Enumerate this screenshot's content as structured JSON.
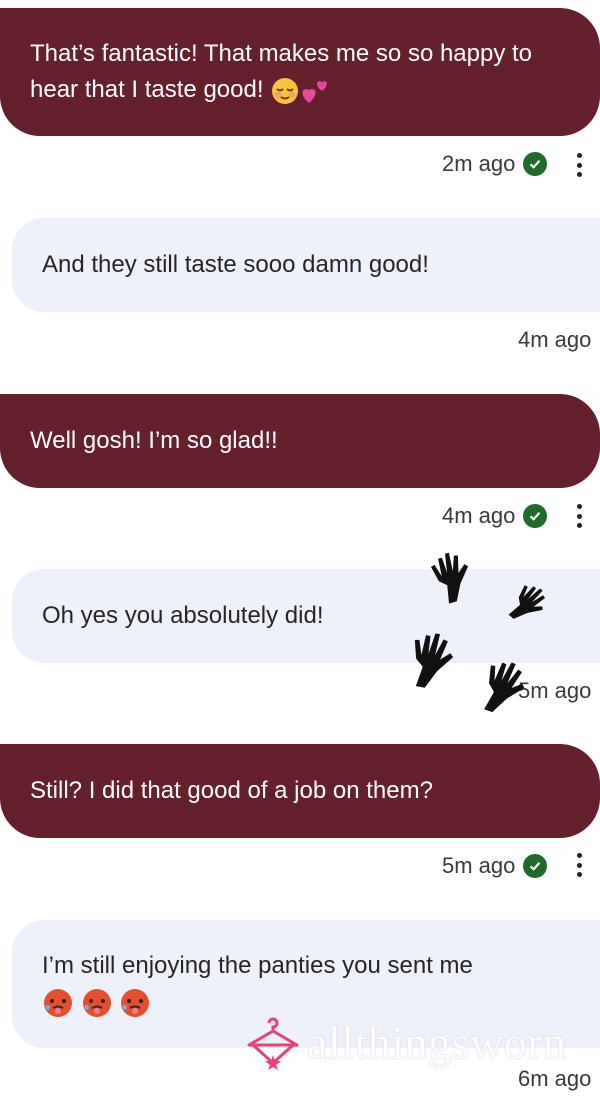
{
  "messages": [
    {
      "role": "sent",
      "text": "That’s fantastic! That makes me so so happy to hear that I taste good!",
      "emoji": [
        "relieved-face",
        "two-hearts"
      ],
      "time": "2m ago"
    },
    {
      "role": "received",
      "text": "And they still taste sooo damn good!",
      "time": "4m ago"
    },
    {
      "role": "sent",
      "text": "Well gosh! I’m so glad!!",
      "time": "4m ago"
    },
    {
      "role": "received",
      "text": "Oh yes you absolutely did!",
      "time": "5m ago"
    },
    {
      "role": "sent",
      "text": "Still? I did that good of a job on them?",
      "time": "5m ago"
    },
    {
      "role": "received",
      "text": "I’m still enjoying the panties you sent me",
      "emoji": [
        "hot-face",
        "hot-face",
        "hot-face"
      ],
      "time": "6m ago"
    }
  ],
  "watermark": {
    "text": "allthingsworn",
    "icon": "hanger-logo-icon"
  },
  "icons": {
    "read": "check-circle-icon",
    "more": "more-vertical-icon",
    "decor": "hand-print-icon"
  },
  "colors": {
    "sent_bubble": "#64212d",
    "received_bubble": "#eef1f9",
    "read_check": "#1e6b2c",
    "watermark_pink": "#e8407a"
  }
}
